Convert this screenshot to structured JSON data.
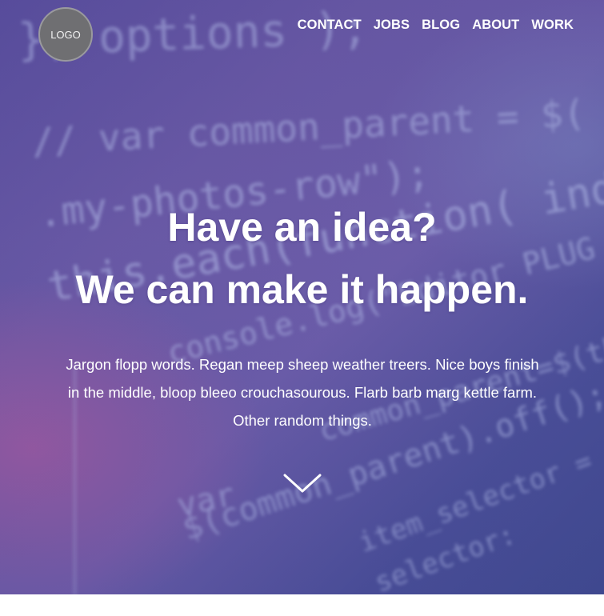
{
  "header": {
    "logo_label": "LOGO",
    "nav": [
      {
        "label": "CONTACT"
      },
      {
        "label": "JOBS"
      },
      {
        "label": "BLOG"
      },
      {
        "label": "ABOUT"
      },
      {
        "label": "WORK"
      }
    ]
  },
  "hero": {
    "headline_line1": "Have an idea?",
    "headline_line2": "We can make it happen.",
    "body": "Jargon flopp words. Regan meep sheep weather treers. Nice boys finish in the middle, bloop bleeo crouchasourous. Flarb barb marg kettle farm. Other random things.",
    "scroll_icon": "chevron-down-icon",
    "background_code": [
      "}, options );",
      "//      var common_parent = $(",
      ".my-photos-row\");",
      "this.each(function( index )",
      "console.log(\"Editor PLUG",
      "common_parent=$(th",
      "$(common_parent).off(); -",
      "var",
      "item_selector =",
      "selector:"
    ]
  },
  "colors": {
    "hero_base": "#5a4f9e",
    "hero_accent": "#aa5aa0",
    "text": "#ffffff",
    "logo_fill": "#6f6f72"
  }
}
